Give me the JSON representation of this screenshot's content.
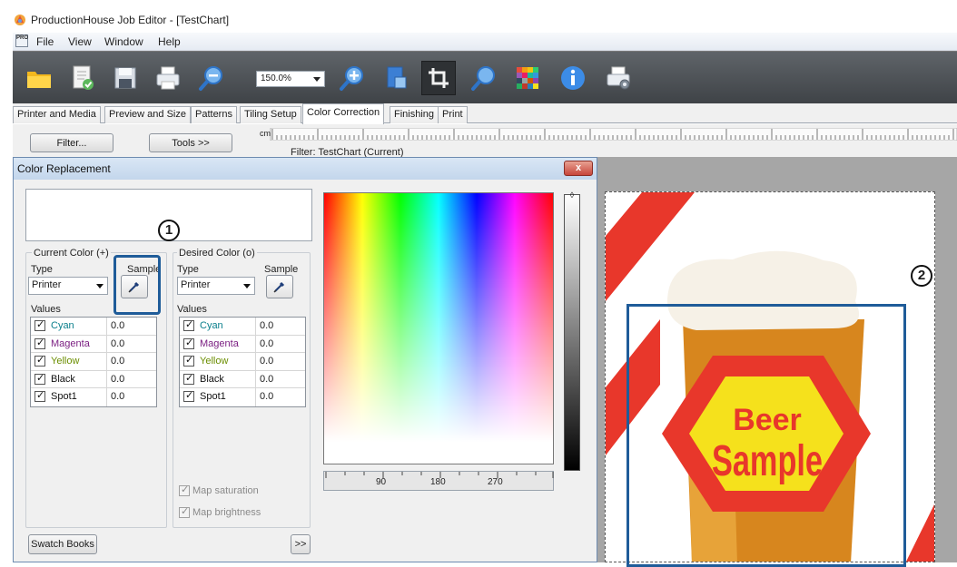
{
  "window": {
    "title": "ProductionHouse Job Editor - [TestChart]"
  },
  "menu": [
    "File",
    "View",
    "Window",
    "Help"
  ],
  "toolbar": {
    "zoom_value": "150.0%",
    "buttons": [
      "open-folder-icon",
      "document-check-icon",
      "save-icon",
      "print-icon",
      "zoom-out-icon",
      "zoom-in-icon",
      "export-icon",
      "crop-icon",
      "search-icon",
      "color-grid-icon",
      "info-icon",
      "print-settings-icon"
    ]
  },
  "tabs": [
    {
      "label": "Printer and Media"
    },
    {
      "label": "Preview and Size"
    },
    {
      "label": "Patterns"
    },
    {
      "label": "Tiling Setup"
    },
    {
      "label": "Color Correction",
      "selected": true
    },
    {
      "label": "Finishing"
    },
    {
      "label": "Print"
    }
  ],
  "filter_row": {
    "filter_button": "Filter...",
    "tools_button": "Tools >>",
    "ruler_unit": "cm",
    "filter_label": "Filter: TestChart (Current)"
  },
  "dialog": {
    "title": "Color Replacement",
    "close_label": "x",
    "current_color": {
      "group_label": "Current Color (+)",
      "type_label": "Type",
      "sample_label": "Sample",
      "type_value": "Printer",
      "values_label": "Values",
      "values": [
        {
          "name": "Cyan",
          "value": "0.0",
          "color": "#0a7f8c"
        },
        {
          "name": "Magenta",
          "value": "0.0",
          "color": "#7b1f82"
        },
        {
          "name": "Yellow",
          "value": "0.0",
          "color": "#6b8e00"
        },
        {
          "name": "Black",
          "value": "0.0",
          "color": "#111111"
        },
        {
          "name": "Spot1",
          "value": "0.0",
          "color": "#111111"
        }
      ]
    },
    "desired_color": {
      "group_label": "Desired Color (o)",
      "type_label": "Type",
      "sample_label": "Sample",
      "type_value": "Printer",
      "values_label": "Values",
      "values": [
        {
          "name": "Cyan",
          "value": "0.0",
          "color": "#0a7f8c"
        },
        {
          "name": "Magenta",
          "value": "0.0",
          "color": "#7b1f82"
        },
        {
          "name": "Yellow",
          "value": "0.0",
          "color": "#6b8e00"
        },
        {
          "name": "Black",
          "value": "0.0",
          "color": "#111111"
        },
        {
          "name": "Spot1",
          "value": "0.0",
          "color": "#111111"
        }
      ]
    },
    "hue_scale": [
      "90",
      "180",
      "270"
    ],
    "map_saturation": "Map saturation",
    "map_brightness": "Map brightness",
    "swatch_books_button": "Swatch Books",
    "more_button": ">>"
  },
  "markers": {
    "one": "1",
    "two": "2"
  },
  "artwork": {
    "line1": "Beer",
    "line2": "Sample"
  },
  "colors": {
    "accent_blue": "#1f5c99",
    "stripe_red": "#e8372b",
    "label_yellow": "#f5e11c"
  }
}
